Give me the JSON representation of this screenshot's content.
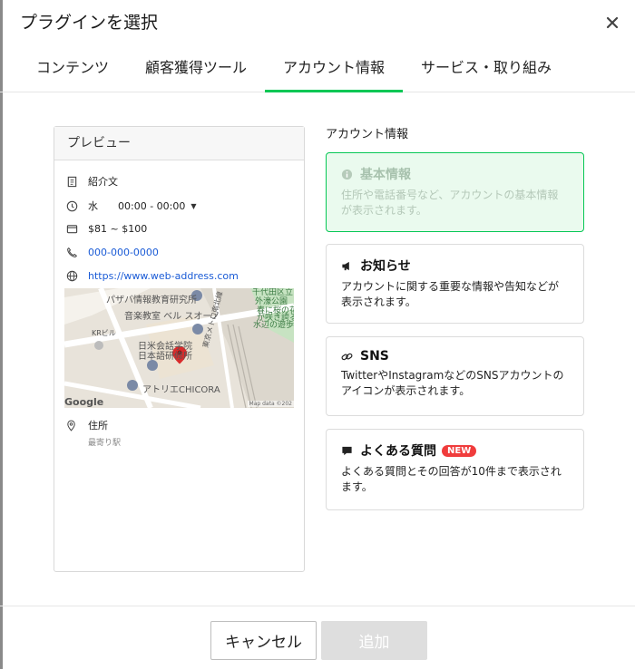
{
  "dialog": {
    "title": "プラグインを選択",
    "close_icon": "close-icon"
  },
  "tabs": [
    {
      "label": "コンテンツ",
      "active": false
    },
    {
      "label": "顧客獲得ツール",
      "active": false
    },
    {
      "label": "アカウント情報",
      "active": true
    },
    {
      "label": "サービス・取り組み",
      "active": false
    }
  ],
  "preview": {
    "header": "プレビュー",
    "intro": "紹介文",
    "day": "水",
    "hours": "00:00 - 00:00",
    "price": "$81 ~ $100",
    "phone": "000-000-0000",
    "website": "https://www.web-address.com",
    "map": {
      "labels": [
        "パザバ情報教育研究所",
        "音楽教室 ベル スオーノ",
        "KRビル",
        "日米会話学院",
        "日本語研修所",
        "アトリエCHICORA",
        "千代田区立",
        "外濠公園",
        "春に桜の花",
        "が咲き誇る",
        "水辺の遊歩道",
        "東京メトロ南北線"
      ],
      "logo": "Google",
      "attribution": "Map data ©202"
    },
    "address_label": "住所",
    "nearest_station": "最寄り駅"
  },
  "section_title": "アカウント情報",
  "cards": [
    {
      "icon": "info-icon",
      "title": "基本情報",
      "description": "住所や電話番号など、アカウントの基本情報が表示されます。",
      "selected": true
    },
    {
      "icon": "megaphone-icon",
      "title": "お知らせ",
      "description": "アカウントに関する重要な情報や告知などが表示されます。",
      "selected": false
    },
    {
      "icon": "link-icon",
      "title": "SNS",
      "description": "TwitterやInstagramなどのSNSアカウントのアイコンが表示されます。",
      "selected": false
    },
    {
      "icon": "chat-icon",
      "title": "よくある質問",
      "badge": "NEW",
      "description": "よくある質問とその回答が10件まで表示されます。",
      "selected": false
    }
  ],
  "footer": {
    "cancel_label": "キャンセル",
    "add_label": "追加"
  },
  "colors": {
    "accent": "#06c755",
    "selected_bg": "#eafaee",
    "badge": "#f03c3c",
    "link": "#1a5bd6"
  }
}
